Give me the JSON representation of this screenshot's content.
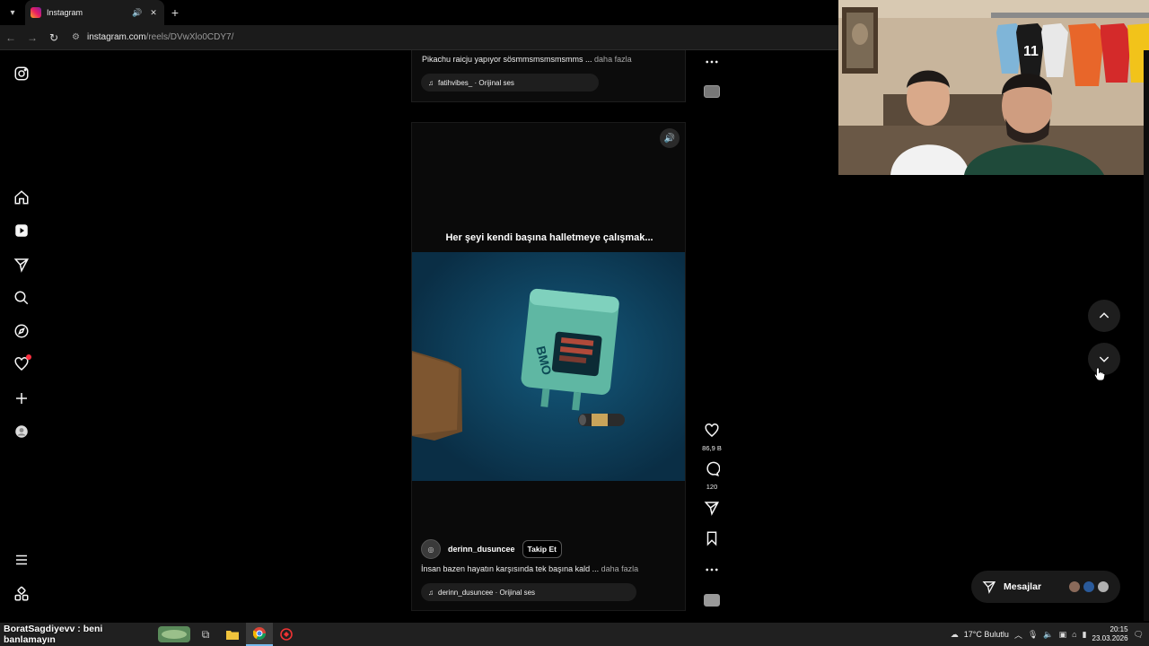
{
  "browser": {
    "tab_title": "Instagram",
    "new_tab": "+",
    "url_host": "instagram.com",
    "url_path": "/reels/DVwXlo0CDY7/"
  },
  "sidebar": {
    "items": [
      "instagram-logo",
      "home",
      "reels",
      "messages",
      "search",
      "explore",
      "notifications",
      "create",
      "profile",
      "more",
      "also-from-meta"
    ]
  },
  "reels": {
    "previous": {
      "caption": "Pikachu raicju yapıyor sösmmsmsmsmsmms ...",
      "more": "daha fazla",
      "audio": "fatihvibes_ · Orijinal ses"
    },
    "current": {
      "overlay_text": "Her şeyi kendi başına halletmeye çalışmak...",
      "author": "derinn_dusuncee",
      "follow": "Takip Et",
      "caption": "İnsan bazen hayatın karşısında tek başına kald ...",
      "more": "daha fazla",
      "audio": "derinn_dusuncee · Orijinal ses",
      "likes": "86,9 B",
      "comments": "120"
    }
  },
  "messages": {
    "label": "Mesajlar"
  },
  "taskbar": {
    "stream_title": "BoratSagdiyevv : beni banlamayın",
    "weather": "17°C  Bulutlu",
    "time": "20:15",
    "date": "23.03.2026"
  },
  "colors": {
    "background": "#000000",
    "notification": "#ff3040",
    "video_bg": "#0b3752"
  }
}
